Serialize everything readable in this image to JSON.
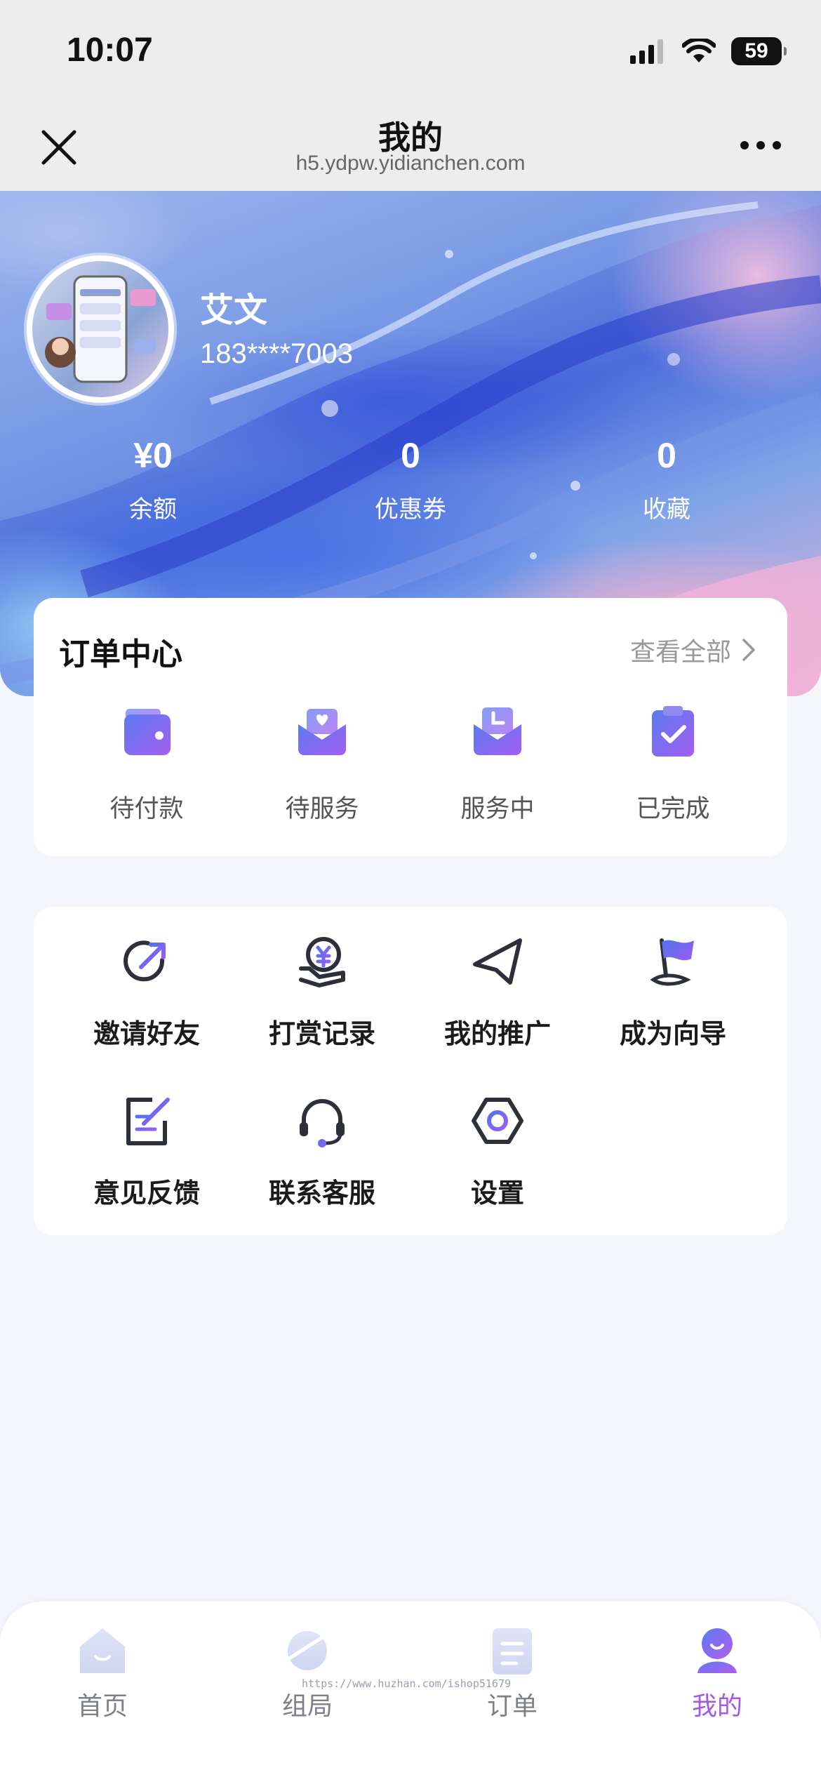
{
  "status_bar": {
    "time": "10:07",
    "battery": "59"
  },
  "nav": {
    "title": "我的",
    "url": "h5.ydpw.yidianchen.com"
  },
  "profile": {
    "name": "艾文",
    "phone": "183****7003",
    "stats": [
      {
        "value": "¥0",
        "label": "余额"
      },
      {
        "value": "0",
        "label": "优惠券"
      },
      {
        "value": "0",
        "label": "收藏"
      }
    ]
  },
  "order_center": {
    "title": "订单中心",
    "view_all": "查看全部",
    "items": [
      {
        "label": "待付款",
        "icon": "wallet-icon"
      },
      {
        "label": "待服务",
        "icon": "heart-box-icon"
      },
      {
        "label": "服务中",
        "icon": "clock-box-icon"
      },
      {
        "label": "已完成",
        "icon": "clipboard-check-icon"
      }
    ]
  },
  "tools": {
    "items": [
      {
        "label": "邀请好友",
        "icon": "share-arrow-icon"
      },
      {
        "label": "打赏记录",
        "icon": "yuan-hand-icon"
      },
      {
        "label": "我的推广",
        "icon": "paper-plane-icon"
      },
      {
        "label": "成为向导",
        "icon": "flag-icon"
      },
      {
        "label": "意见反馈",
        "icon": "feedback-edit-icon"
      },
      {
        "label": "联系客服",
        "icon": "headset-icon"
      },
      {
        "label": "设置",
        "icon": "settings-hexagon-icon"
      }
    ]
  },
  "tab_bar": {
    "tabs": [
      {
        "label": "首页",
        "icon": "home-icon"
      },
      {
        "label": "组局",
        "icon": "planet-icon"
      },
      {
        "label": "订单",
        "icon": "order-list-icon"
      },
      {
        "label": "我的",
        "icon": "profile-icon",
        "active": true
      }
    ]
  },
  "watermark": "https://www.huzhan.com/ishop51679",
  "colors": {
    "accent_purple": "#a358e6",
    "icon_gradient_start": "#5b7bf2",
    "icon_gradient_end": "#a35ef0",
    "background": "#f5f6fb"
  }
}
